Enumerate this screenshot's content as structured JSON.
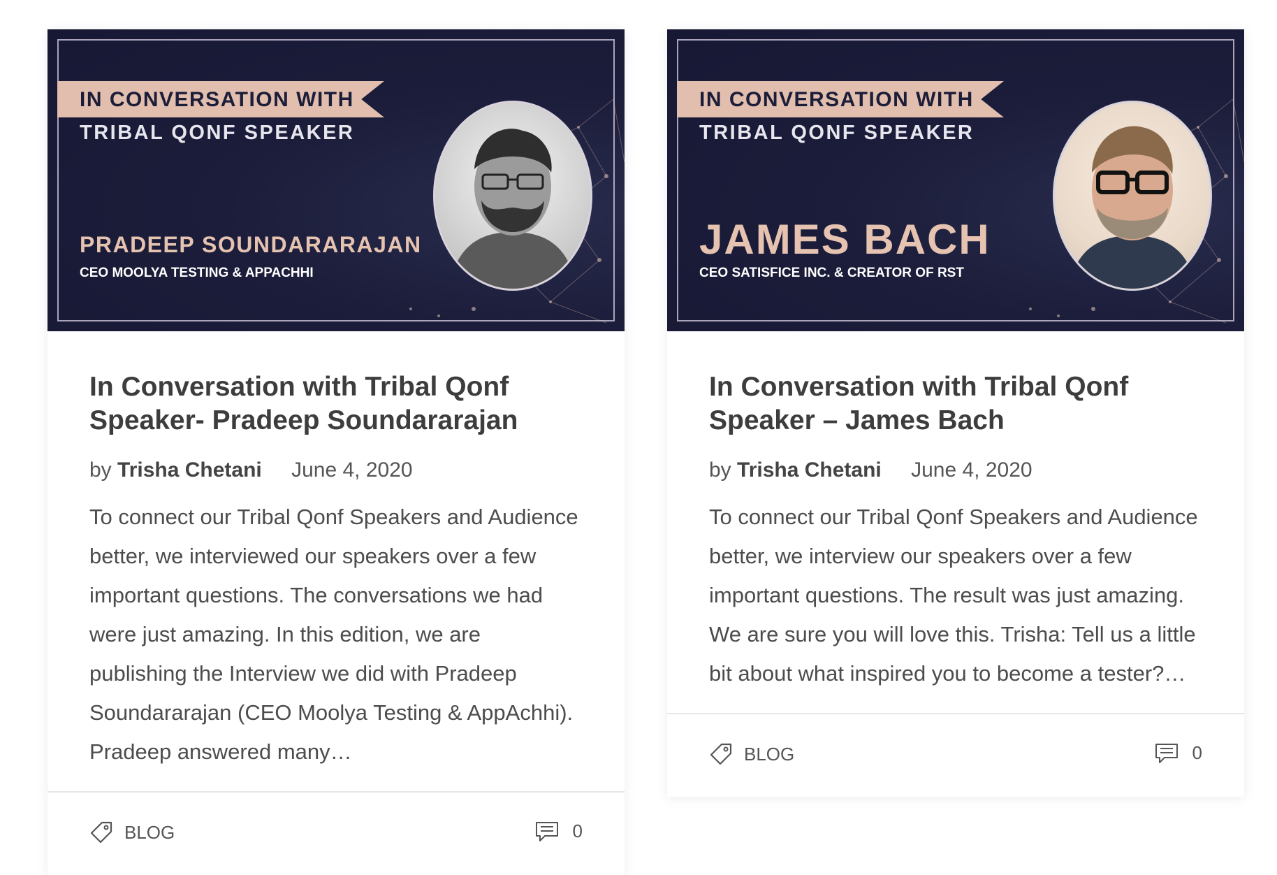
{
  "posts": [
    {
      "banner": {
        "ribbon_text": "IN CONVERSATION WITH",
        "subline": "TRIBAL QONF SPEAKER",
        "speaker_name": "PRADEEP SOUNDARARAJAN",
        "speaker_role": "CEO MOOLYA TESTING & APPACHHI"
      },
      "title": "In Conversation with Tribal Qonf Speaker- Pradeep Soundararajan",
      "by_label": "by",
      "author": "Trisha Chetani",
      "date": "June 4, 2020",
      "excerpt": "To connect our Tribal Qonf Speakers and Audience better, we interviewed our speakers over a few important questions. The conversations we had were just amazing.  In this edition, we are publishing the Interview we did with Pradeep Soundararajan (CEO Moolya Testing & AppAchhi). Pradeep answered many…",
      "category": "BLOG",
      "comment_count": "0"
    },
    {
      "banner": {
        "ribbon_text": "IN CONVERSATION WITH",
        "subline": "TRIBAL QONF SPEAKER",
        "speaker_name": "JAMES BACH",
        "speaker_role": "CEO SATISFICE INC. & CREATOR OF RST"
      },
      "title": "In Conversation with Tribal Qonf Speaker – James Bach",
      "by_label": "by",
      "author": "Trisha Chetani",
      "date": "June 4, 2020",
      "excerpt": "To connect our Tribal Qonf Speakers and Audience better, we interview our speakers over a few important questions. The result was just amazing. We are sure you will love this. Trisha: Tell us a little bit about what inspired you to become a tester?…",
      "category": "BLOG",
      "comment_count": "0"
    }
  ],
  "icons": {
    "category": "tag-icon",
    "comments": "comment-icon"
  },
  "colors": {
    "banner_bg": "#1b1d3a",
    "ribbon": "#e2beae",
    "name_accent": "#e6c2b1"
  }
}
